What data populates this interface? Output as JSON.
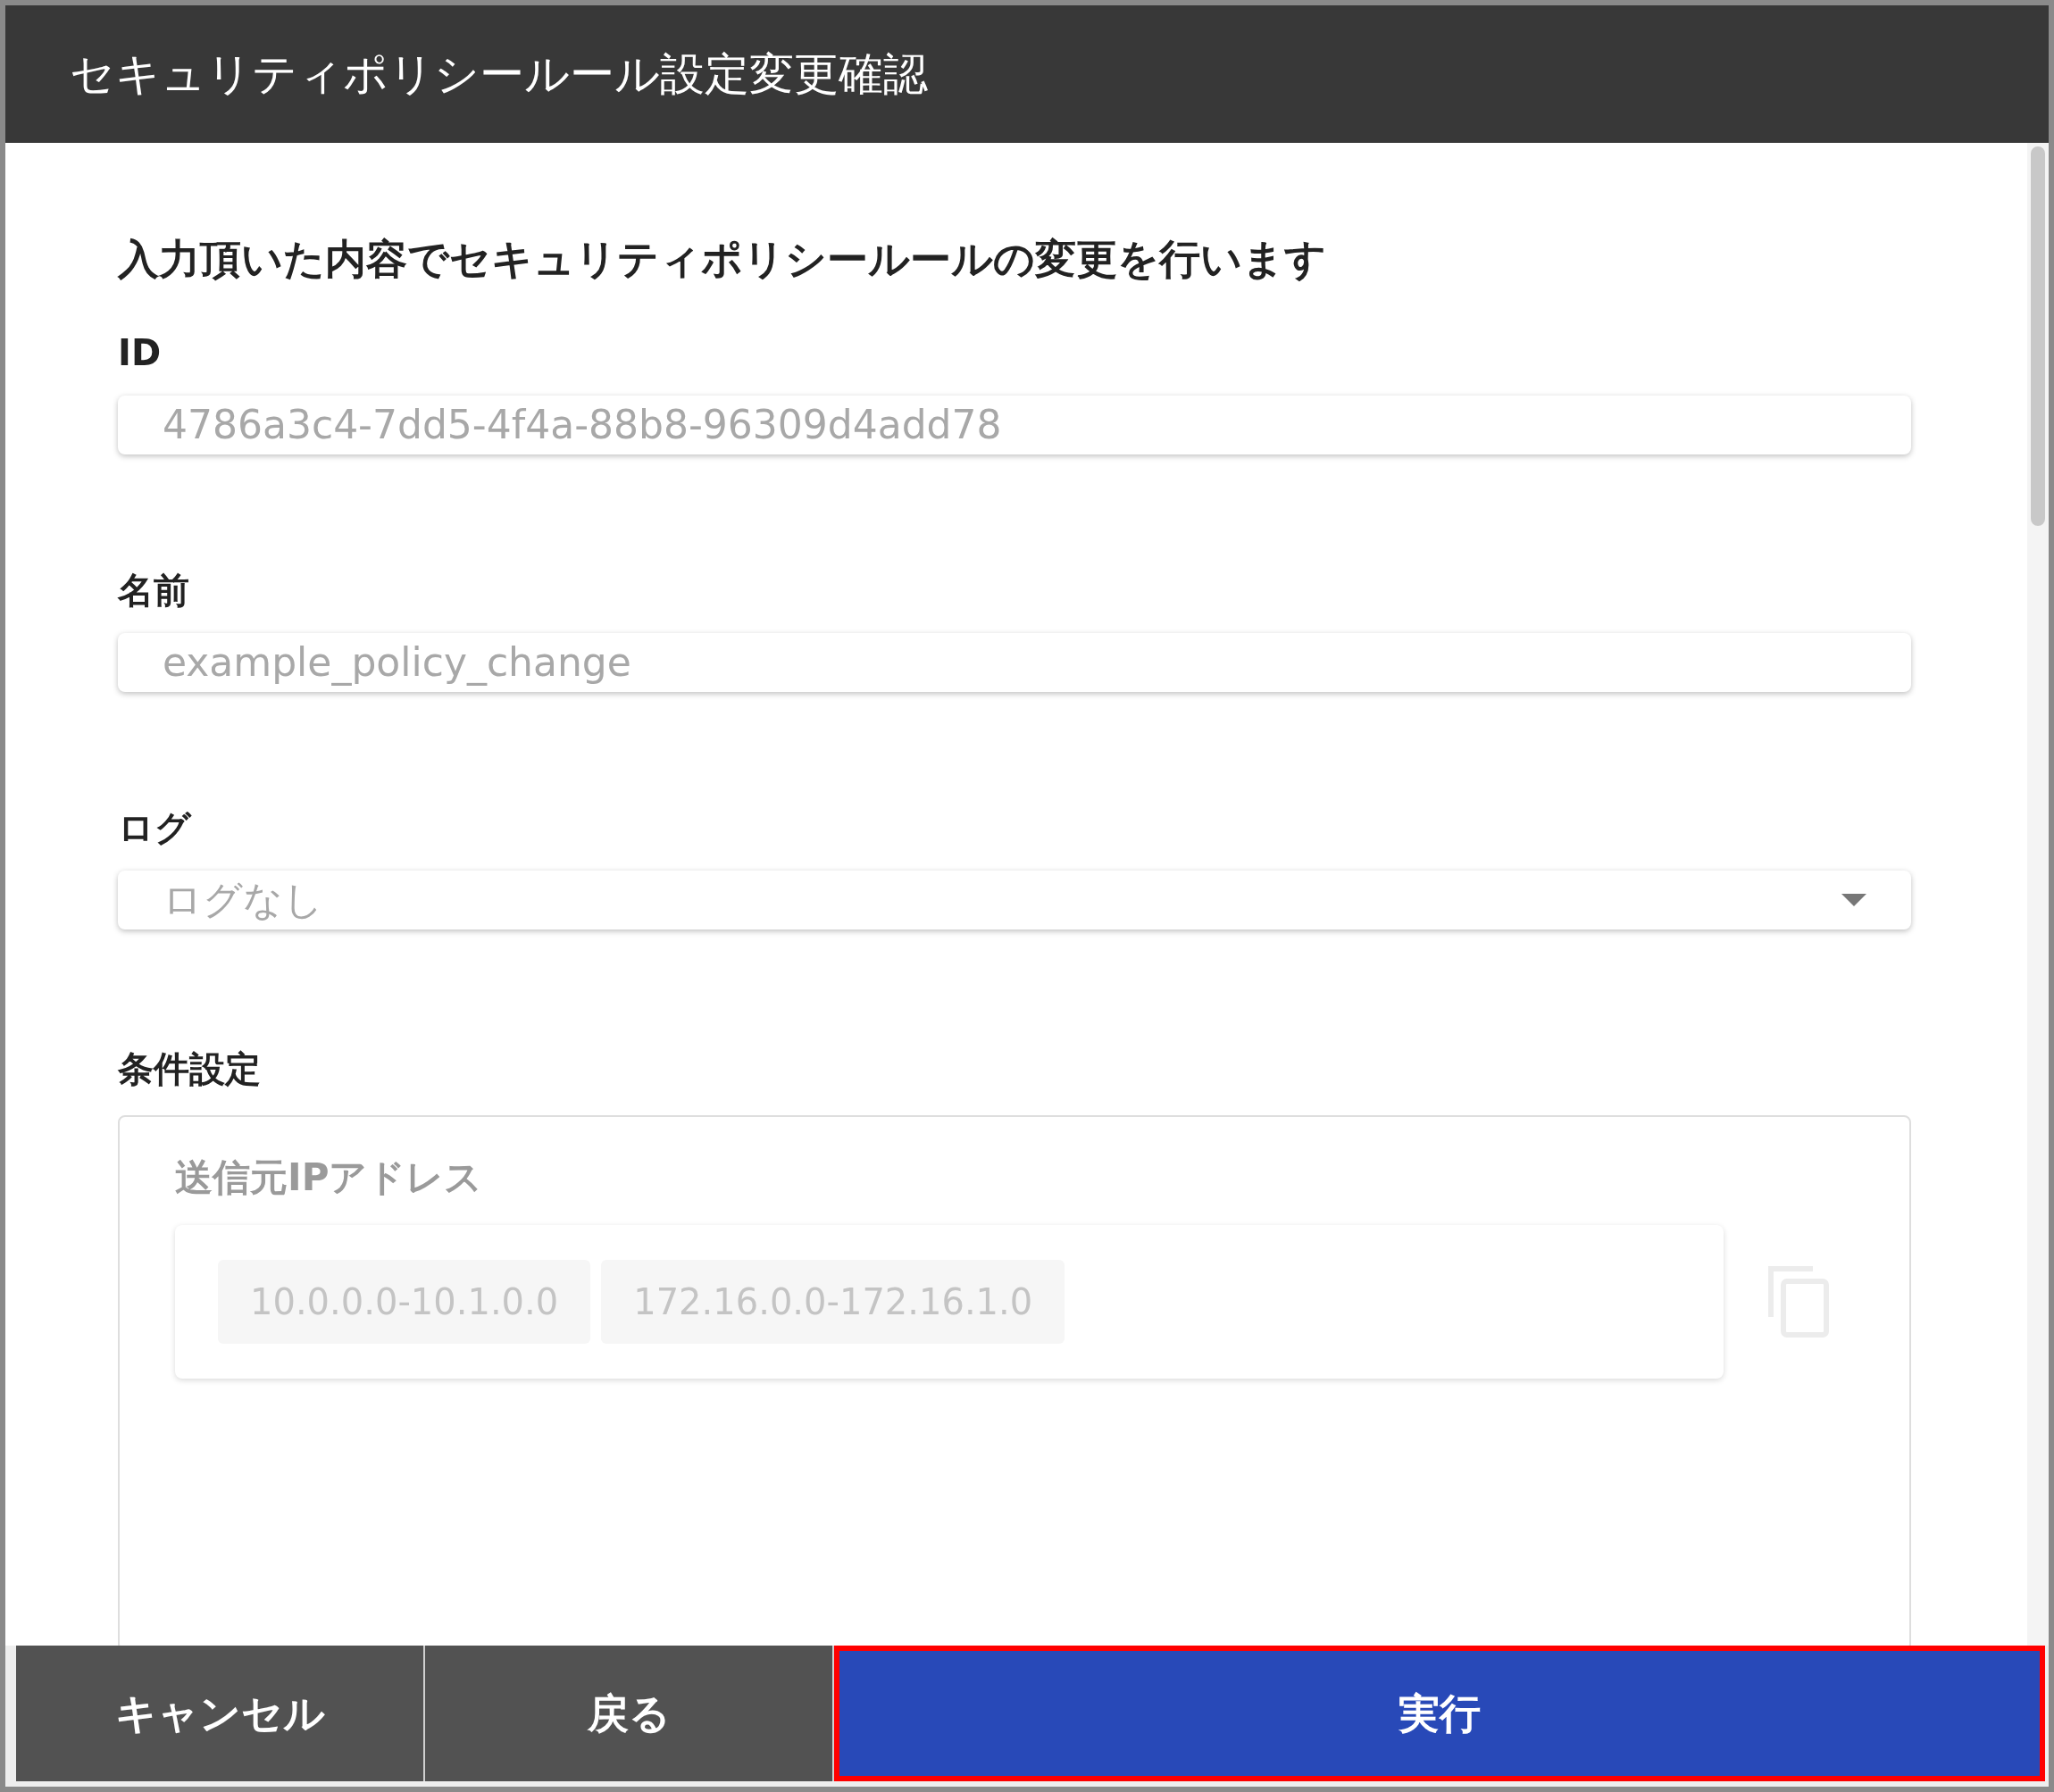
{
  "dialog": {
    "title": "セキュリティポリシールール設定変更確認"
  },
  "message": "入力頂いた内容でセキュリティポリシールールの変更を行います",
  "fields": [
    {
      "kind": "text",
      "label": "ID",
      "value": "4786a3c4-7dd5-4f4a-88b8-96309d4add78"
    },
    {
      "kind": "text",
      "label": "名前",
      "value": "example_policy_change"
    },
    {
      "kind": "select",
      "label": "ログ",
      "value": "ログなし"
    }
  ],
  "conditions": {
    "label": "条件設定",
    "groups": [
      {
        "label": "送信元IPアドレス",
        "chips": [
          "10.0.0.0-10.1.0.0",
          "172.16.0.0-172.16.1.0"
        ]
      }
    ]
  },
  "buttons": [
    {
      "label": "キャンセル",
      "kind": "secondary",
      "highlighted": false
    },
    {
      "label": "戻る",
      "kind": "secondary",
      "highlighted": false
    },
    {
      "label": "実行",
      "kind": "primary",
      "highlighted": true
    }
  ]
}
